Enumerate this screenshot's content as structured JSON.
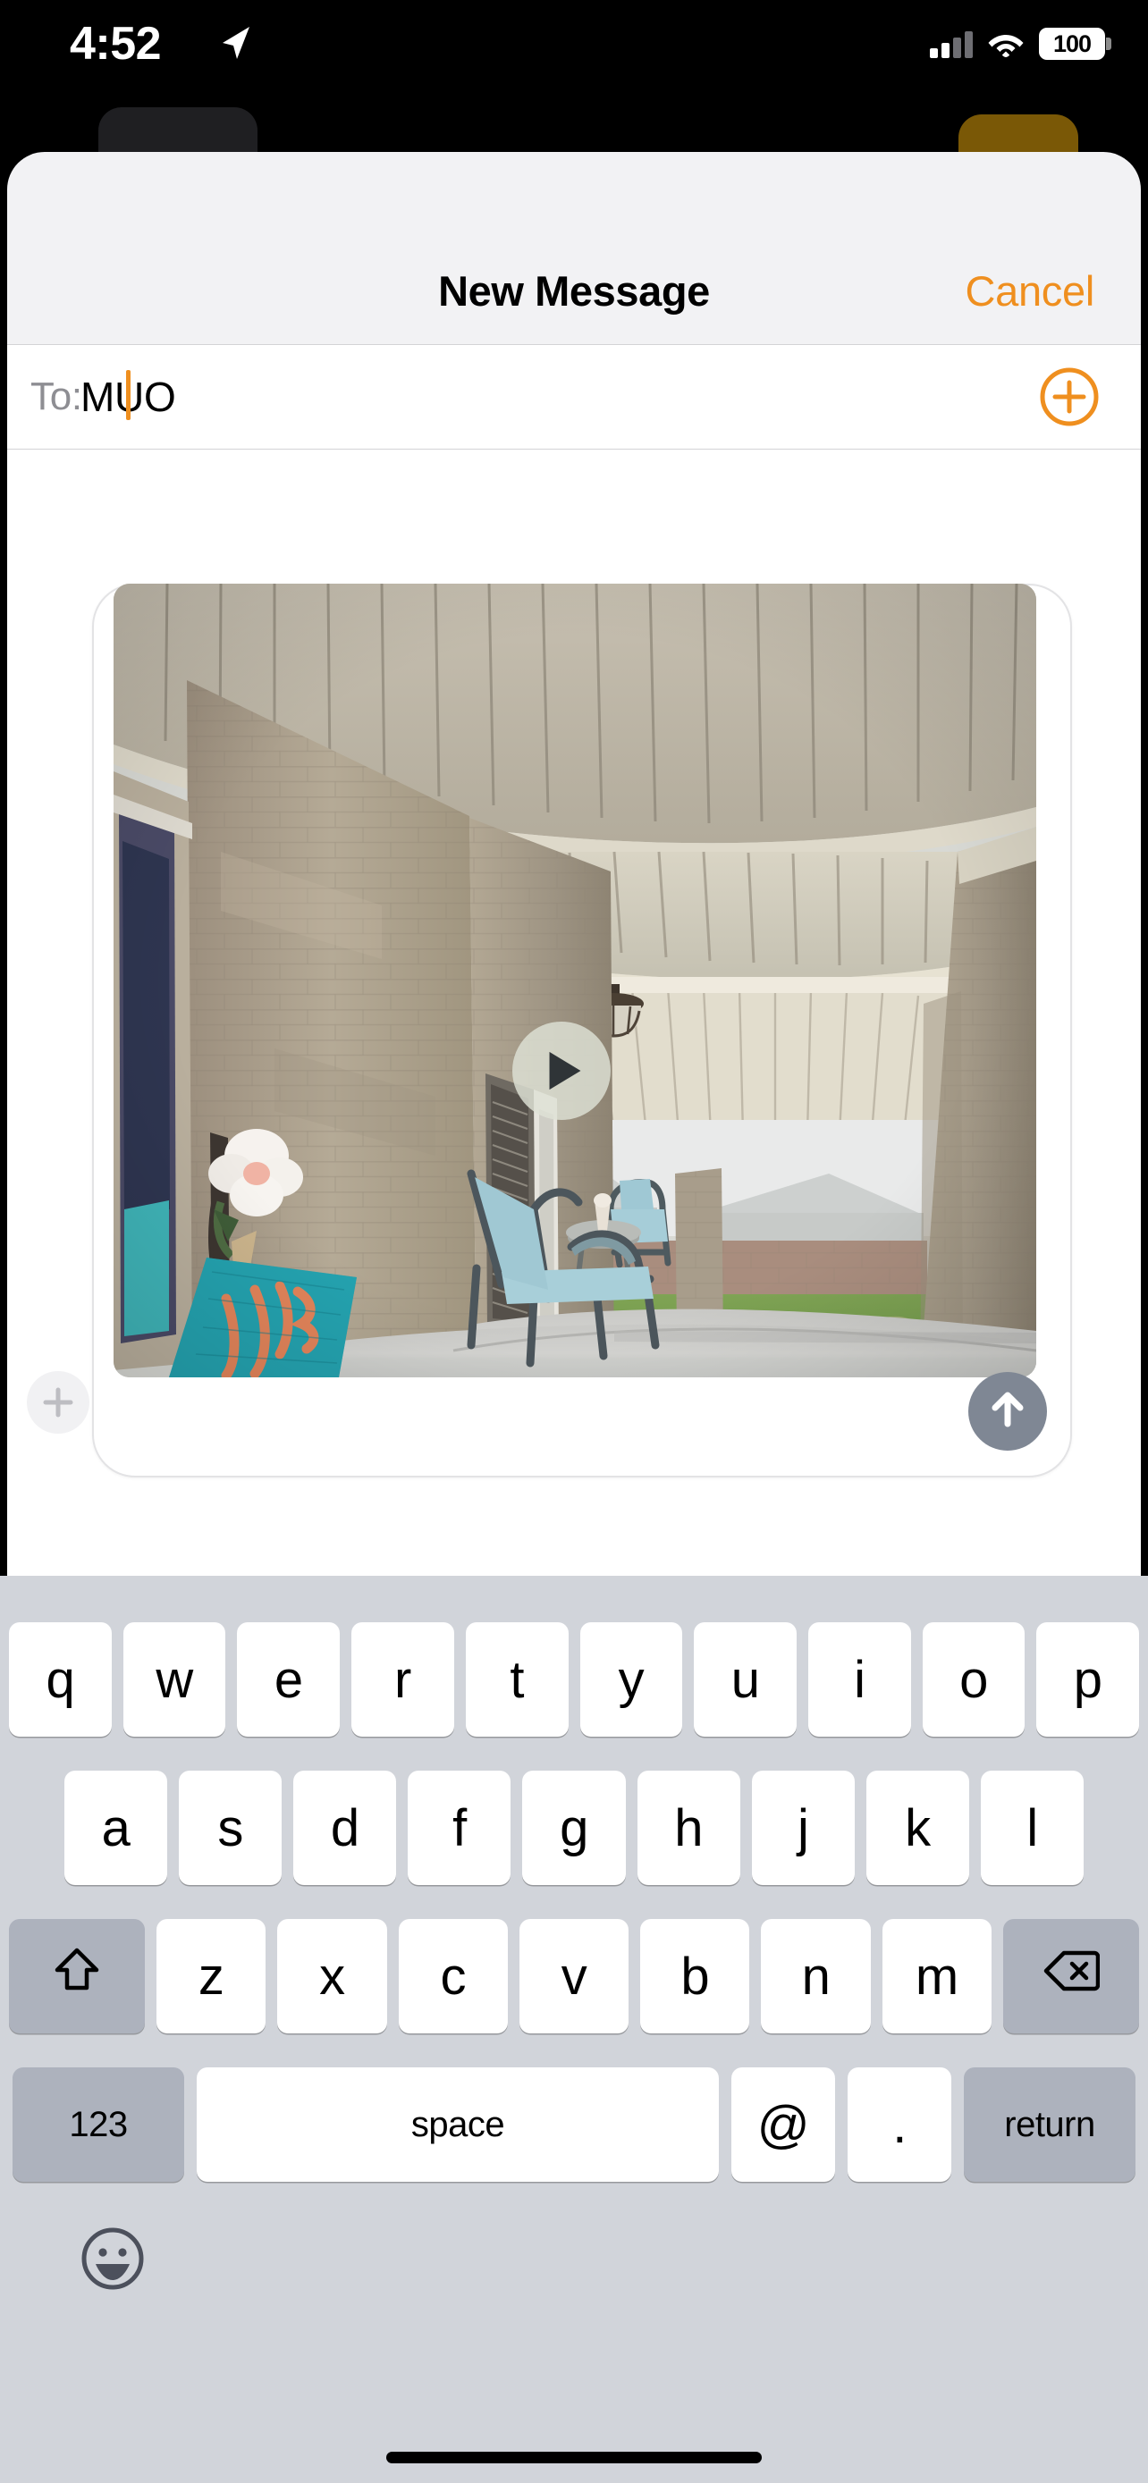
{
  "status_bar": {
    "time": "4:52",
    "location_icon": "location-arrow-icon",
    "cellular_icon": "cellular-bars-icon",
    "wifi_icon": "wifi-icon",
    "battery_level": "100",
    "battery_icon": "battery-full-icon"
  },
  "sheet": {
    "title": "New Message",
    "cancel_label": "Cancel",
    "accent_color": "#ef8f1f",
    "background_color": "#f2f2f4"
  },
  "recipient_field": {
    "label": "To:",
    "value": "MUO",
    "placeholder": "To:",
    "caret_color": "#ef8f1f",
    "add_contact_icon": "plus-circle-icon"
  },
  "compose": {
    "attach_icon": "plus-icon",
    "send_icon": "arrow-up-icon",
    "send_button_color": "#7f8794",
    "attachment": {
      "kind": "video",
      "play_icon": "play-triangle-icon",
      "description": "Front porch doorbell camera video thumbnail",
      "scene": {
        "ceiling": "beige vinyl soffit with vertical ribs",
        "columns": "tan brick porch columns",
        "floor": "light gray concrete porch",
        "door_mat": "teal mat with orange script lettering",
        "chairs": "two light blue metal patio chairs",
        "side_table": "small round gray table",
        "light_fixture": "bronze ceiling dome light",
        "wall_decor": "white and pink flower on left wall",
        "background": "green lawn and neighboring brick house",
        "sky": "overcast white sky"
      }
    }
  },
  "keyboard": {
    "background_color": "#d1d4da",
    "key_color": "#ffffff",
    "modifier_key_color": "#adb2bd",
    "row1": [
      "q",
      "w",
      "e",
      "r",
      "t",
      "y",
      "u",
      "i",
      "o",
      "p"
    ],
    "row2": [
      "a",
      "s",
      "d",
      "f",
      "g",
      "h",
      "j",
      "k",
      "l"
    ],
    "row3_letters": [
      "z",
      "x",
      "c",
      "v",
      "b",
      "n",
      "m"
    ],
    "shift_icon": "shift-arrow-up-icon",
    "backspace_icon": "delete-left-icon",
    "numbers_label": "123",
    "space_label": "space",
    "at_label": "@",
    "period_label": ".",
    "return_label": "return",
    "emoji_icon": "emoji-smiley-icon"
  },
  "home_indicator": "home-bar"
}
